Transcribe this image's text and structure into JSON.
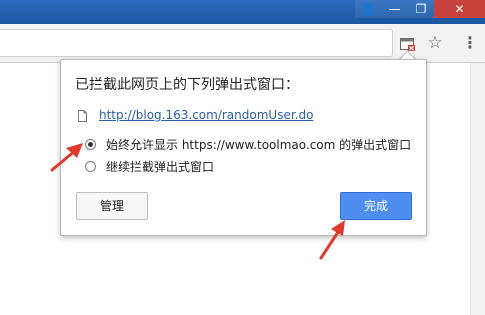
{
  "window_controls": {
    "user_glyph": "👤",
    "min_glyph": "—",
    "max_glyph": "❐",
    "close_glyph": "✕"
  },
  "toolbar": {
    "star_glyph": "☆",
    "menu_glyph": "⋮"
  },
  "popup": {
    "title": "已拦截此网页上的下列弹出式窗口：",
    "link_text": "http://blog.163.com/randomUser.do",
    "options": [
      {
        "label": "始终允许显示 https://www.toolmao.com 的弹出式窗口",
        "checked": true
      },
      {
        "label": "继续拦截弹出式窗口",
        "checked": false
      }
    ],
    "manage_label": "管理",
    "done_label": "完成"
  },
  "colors": {
    "annotation_red": "#e03a2f",
    "titlebar_blue": "#1f5fa8",
    "primary_button": "#4d8ef0"
  },
  "icons": {
    "popup_blocked": "popup-blocked-icon",
    "bookmark": "star-icon",
    "menu": "menu-icon",
    "document": "document-icon"
  }
}
